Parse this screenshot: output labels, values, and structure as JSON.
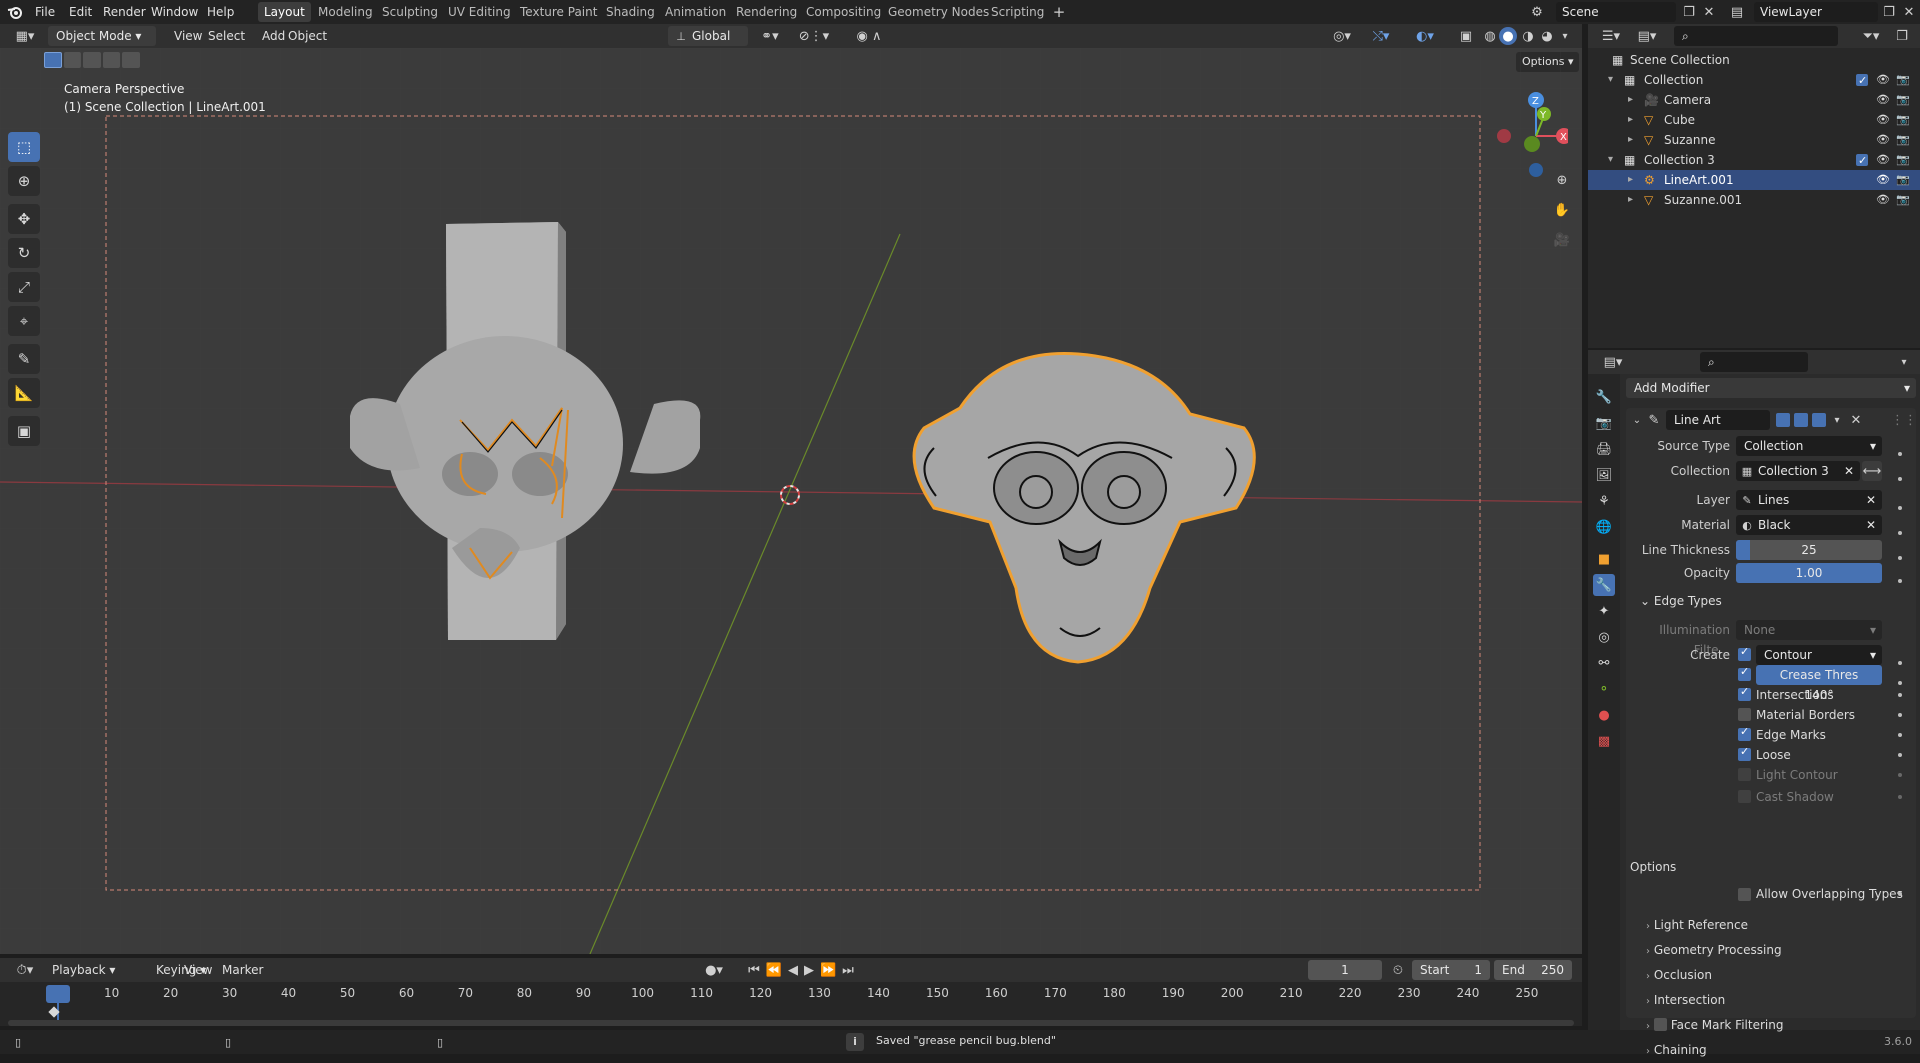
{
  "menu": [
    "File",
    "Edit",
    "Render",
    "Window",
    "Help"
  ],
  "workspaces": [
    "Layout",
    "Modeling",
    "Sculpting",
    "UV Editing",
    "Texture Paint",
    "Shading",
    "Animation",
    "Rendering",
    "Compositing",
    "Geometry Nodes",
    "Scripting"
  ],
  "scene_name": "Scene",
  "view_layer": "ViewLayer",
  "viewport_header": {
    "mode": "Object Mode",
    "menus": [
      "View",
      "Select",
      "Add",
      "Object"
    ],
    "orientation": "Global",
    "options": "Options"
  },
  "viewport": {
    "camera_label": "Camera Perspective",
    "context_label": "(1) Scene Collection | LineArt.001",
    "gizmo": {
      "z": "Z",
      "y": "Y",
      "x": "X"
    }
  },
  "outliner": {
    "root": "Scene Collection",
    "rows": [
      {
        "label": "Collection",
        "kind": "collection"
      },
      {
        "label": "Camera",
        "kind": "camera"
      },
      {
        "label": "Cube",
        "kind": "mesh"
      },
      {
        "label": "Suzanne",
        "kind": "mesh"
      },
      {
        "label": "Collection 3",
        "kind": "collection"
      },
      {
        "label": "LineArt.001",
        "kind": "gpencil",
        "selected": true
      },
      {
        "label": "Suzanne.001",
        "kind": "mesh"
      }
    ]
  },
  "properties": {
    "add_modifier": "Add Modifier",
    "modifier_name": "Line Art",
    "source_type_label": "Source Type",
    "source_type": "Collection",
    "collection_label": "Collection",
    "collection": "Collection 3",
    "layer_label": "Layer",
    "layer": "Lines",
    "material_label": "Material",
    "material": "Black",
    "line_thickness_label": "Line Thickness",
    "line_thickness": "25",
    "opacity_label": "Opacity",
    "opacity": "1.00",
    "edge_types_label": "Edge Types",
    "illumination_label": "Illumination Filte...",
    "illumination": "None",
    "create_label": "Create",
    "contour": "Contour",
    "crease_label": "Crease Thres",
    "crease_value": "140°",
    "edge_checks": [
      {
        "label": "Intersections",
        "checked": true,
        "enabled": true
      },
      {
        "label": "Material Borders",
        "checked": false,
        "enabled": true
      },
      {
        "label": "Edge Marks",
        "checked": true,
        "enabled": true
      },
      {
        "label": "Loose",
        "checked": true,
        "enabled": true
      },
      {
        "label": "Light Contour",
        "checked": false,
        "enabled": false
      },
      {
        "label": "Cast Shadow",
        "checked": false,
        "enabled": false
      }
    ],
    "options_label": "Options",
    "allow_overlap": "Allow Overlapping Types",
    "subpanels": [
      "Light Reference",
      "Geometry Processing",
      "Occlusion",
      "Intersection",
      "Face Mark Filtering",
      "Chaining"
    ]
  },
  "timeline": {
    "menus": [
      "Playback",
      "Keying",
      "View",
      "Marker"
    ],
    "current_frame": "1",
    "start_label": "Start",
    "start": "1",
    "end_label": "End",
    "end": "250",
    "ticks": [
      "1",
      "10",
      "20",
      "30",
      "40",
      "50",
      "60",
      "70",
      "80",
      "90",
      "100",
      "110",
      "120",
      "130",
      "140",
      "150",
      "160",
      "170",
      "180",
      "190",
      "200",
      "210",
      "220",
      "230",
      "240",
      "250"
    ]
  },
  "status": {
    "message": "Saved \"grease pencil bug.blend\"",
    "version": "3.6.0"
  },
  "colors": {
    "accent": "#4772b3",
    "selection_outline": "#f0a030",
    "x_axis": "#e0505c",
    "y_axis": "#7db828",
    "z_axis": "#4a8fe0"
  }
}
